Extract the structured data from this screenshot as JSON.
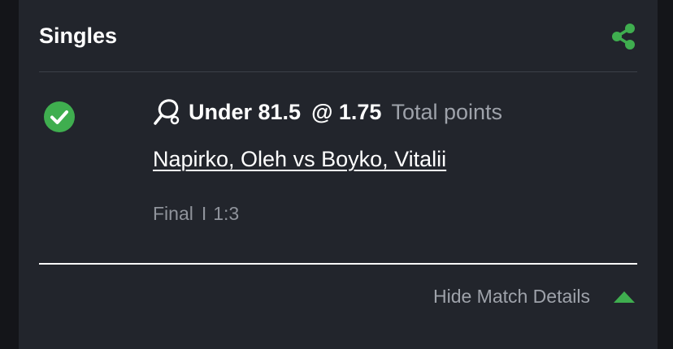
{
  "card": {
    "title": "Singles",
    "share_icon": "share-icon"
  },
  "bet": {
    "status_icon": "check-circle-icon",
    "sport_icon": "table-tennis-icon",
    "selection": "Under 81.5",
    "odds": "@ 1.75",
    "market": "Total points",
    "match": "Napirko, Oleh vs Boyko, Vitalii",
    "status": "Final",
    "separator": "I",
    "score": "1:3"
  },
  "details": {
    "toggle_label": "Hide Match Details",
    "toggle_icon": "triangle-up-icon"
  },
  "colors": {
    "background": "#22252c",
    "accent_green": "#3fae4f",
    "text_primary": "#ffffff",
    "text_secondary": "#9ea2aa"
  }
}
